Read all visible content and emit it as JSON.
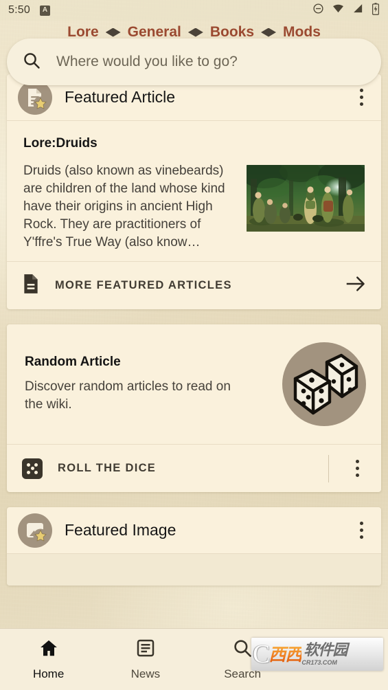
{
  "statusbar": {
    "clock": "5:50",
    "app_badge": "A",
    "icons": [
      "do-not-disturb-icon",
      "wifi-icon",
      "cell-signal-icon",
      "battery-charging-icon"
    ]
  },
  "topnav": {
    "items": [
      {
        "label": "Lore"
      },
      {
        "label": "General"
      },
      {
        "label": "Books"
      },
      {
        "label": "Mods"
      }
    ],
    "separator": "diamond-separator-icon",
    "accent_color": "#9b4a31"
  },
  "search": {
    "icon": "search-icon",
    "placeholder": "Where would you like to go?",
    "value": ""
  },
  "cards": {
    "featured_article": {
      "icon": "featured-article-star-icon",
      "header_title": "Featured Article",
      "overflow_icon": "more-vert-icon",
      "article_title": "Lore:Druids",
      "article_excerpt": "Druids (also known as vinebeards) are children of the land whose kind have their origins in ancient High Rock. They are practitioners of Y'ffre's True Way (also know…",
      "thumbnail_alt": "druids-artwork-thumbnail",
      "action_icon": "article-document-icon",
      "action_label": "MORE FEATURED ARTICLES",
      "action_arrow_icon": "arrow-right-icon"
    },
    "random_article": {
      "title": "Random Article",
      "description": "Discover random articles to read on the wiki.",
      "illustration": "two-dice-icon",
      "action_icon": "die-five-icon",
      "action_label": "ROLL THE DICE",
      "overflow_icon": "more-vert-icon"
    },
    "featured_image": {
      "icon": "featured-image-star-icon",
      "header_title": "Featured Image",
      "overflow_icon": "more-vert-icon"
    }
  },
  "bottomnav": {
    "items": [
      {
        "label": "Home",
        "icon": "home-icon",
        "active": true
      },
      {
        "label": "News",
        "icon": "news-icon",
        "active": false
      },
      {
        "label": "Search",
        "icon": "search-icon",
        "active": false
      },
      {
        "label": "",
        "icon": "more-horiz-icon",
        "active": false
      }
    ]
  },
  "watermark": {
    "mark": "C",
    "brand_cn": "西西",
    "brand_cn2": "软件园",
    "url": "CR173.COM"
  },
  "colors": {
    "page_background": "#e9dec2",
    "card_background": "#faf1dc",
    "search_background": "#f7f0dd",
    "accent_link": "#9b4a31",
    "avatar_circle": "#a2937f",
    "star_gold": "#e8cd72",
    "text_primary": "#151515",
    "text_secondary": "#46423b"
  }
}
